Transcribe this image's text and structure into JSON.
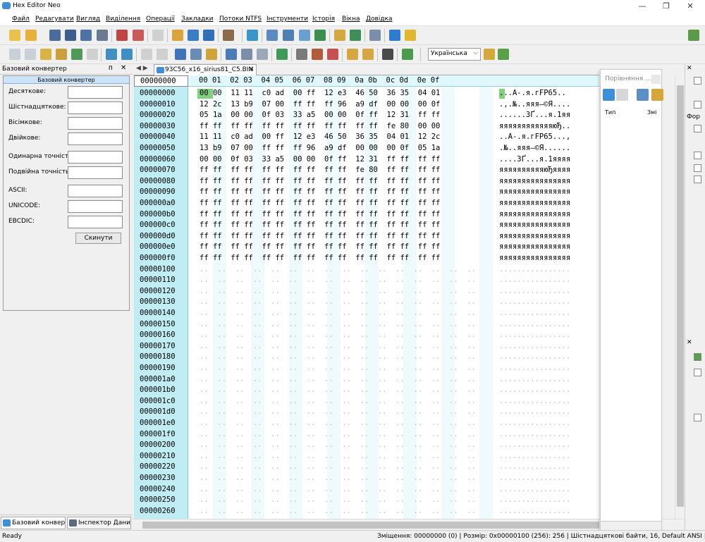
{
  "window": {
    "title": "Hex Editor Neo",
    "min": "—",
    "restore": "❐",
    "close": "✕"
  },
  "menu": [
    "Файл",
    "Редагувати",
    "Вигляд",
    "Виділення",
    "Операції",
    "Закладки",
    "Потоки NTFS",
    "Інструменти",
    "Історія",
    "Вікна",
    "Довідка"
  ],
  "toolbar": {
    "language": "Українська",
    "language_arrow": "⌵"
  },
  "converter": {
    "panel_title": "Базовий конвертер",
    "pin": "ᴨ",
    "close": "✕",
    "header": "Базовий конвертер",
    "fields": [
      {
        "label": "Десяткове:",
        "value": ""
      },
      {
        "label": "Шістнадцяткове:",
        "value": ""
      },
      {
        "label": "Вісімкове:",
        "value": ""
      },
      {
        "label": "Двійкове:",
        "value": ""
      },
      {
        "label": "Одинарна точність:",
        "value": ""
      },
      {
        "label": "Подвійна точність:",
        "value": ""
      },
      {
        "label": "ASCII:",
        "value": ""
      },
      {
        "label": "UNICODE:",
        "value": ""
      },
      {
        "label": "EBCDIC:",
        "value": ""
      }
    ],
    "reset_label": "Скинути"
  },
  "bottom_tabs": [
    "Базовий конвер...",
    "Інспектор Даних"
  ],
  "document": {
    "tab_label": "93C56_x16_sirius81_C5.BIN",
    "nav": "◀ ▶",
    "close": "✕"
  },
  "hex": {
    "offset_header": "00000000",
    "column_header": "00 01  02 03  04 05  06 07  08 09  0a 0b  0c 0d  0e 0f",
    "rows": [
      {
        "offset": "00000000",
        "hex": "00 00  11 11  c0 ad  00 ff  12 e3  46 50  36 35  04 01",
        "ascii": "...А-.я.гFP65.."
      },
      {
        "offset": "00000010",
        "hex": "12 2c  13 b9  07 00  ff ff  ff 96  a9 df  00 00  00 0f",
        "ascii": ".,.№..яяя–©Я...."
      },
      {
        "offset": "00000020",
        "hex": "05 1a  00 00  0f 03  33 a5  00 00  0f ff  12 31  ff ff",
        "ascii": "......3Ґ...я.1яя"
      },
      {
        "offset": "00000030",
        "hex": "ff ff  ff ff  ff ff  ff ff  ff ff  ff ff  fe 80  00 00",
        "ascii": "яяяяяяяяяяяяюЂ.."
      },
      {
        "offset": "00000040",
        "hex": "11 11  c0 ad  00 ff  12 e3  46 50  36 35  04 01  12 2c",
        "ascii": "..А-.я.гFP65...,"
      },
      {
        "offset": "00000050",
        "hex": "13 b9  07 00  ff ff  ff 96  a9 df  00 00  00 0f  05 1a",
        "ascii": ".№..яяя–©Я......"
      },
      {
        "offset": "00000060",
        "hex": "00 00  0f 03  33 a5  00 00  0f ff  12 31  ff ff  ff ff",
        "ascii": "....3Ґ...я.1яяяя"
      },
      {
        "offset": "00000070",
        "hex": "ff ff  ff ff  ff ff  ff ff  ff ff  fe 80  ff ff  ff ff",
        "ascii": "яяяяяяяяяяюЂяяяя"
      },
      {
        "offset": "00000080",
        "hex": "ff ff  ff ff  ff ff  ff ff  ff ff  ff ff  ff ff  ff ff",
        "ascii": "яяяяяяяяяяяяяяяя"
      },
      {
        "offset": "00000090",
        "hex": "ff ff  ff ff  ff ff  ff ff  ff ff  ff ff  ff ff  ff ff",
        "ascii": "яяяяяяяяяяяяяяяя"
      },
      {
        "offset": "000000a0",
        "hex": "ff ff  ff ff  ff ff  ff ff  ff ff  ff ff  ff ff  ff ff",
        "ascii": "яяяяяяяяяяяяяяяя"
      },
      {
        "offset": "000000b0",
        "hex": "ff ff  ff ff  ff ff  ff ff  ff ff  ff ff  ff ff  ff ff",
        "ascii": "яяяяяяяяяяяяяяяя"
      },
      {
        "offset": "000000c0",
        "hex": "ff ff  ff ff  ff ff  ff ff  ff ff  ff ff  ff ff  ff ff",
        "ascii": "яяяяяяяяяяяяяяяя"
      },
      {
        "offset": "000000d0",
        "hex": "ff ff  ff ff  ff ff  ff ff  ff ff  ff ff  ff ff  ff ff",
        "ascii": "яяяяяяяяяяяяяяяя"
      },
      {
        "offset": "000000e0",
        "hex": "ff ff  ff ff  ff ff  ff ff  ff ff  ff ff  ff ff  ff ff",
        "ascii": "яяяяяяяяяяяяяяяя"
      },
      {
        "offset": "000000f0",
        "hex": "ff ff  ff ff  ff ff  ff ff  ff ff  ff ff  ff ff  ff ff",
        "ascii": "яяяяяяяяяяяяяяяя"
      }
    ],
    "empty_offsets": [
      "00000100",
      "00000110",
      "00000120",
      "00000130",
      "00000140",
      "00000150",
      "00000160",
      "00000170",
      "00000180",
      "00000190",
      "000001a0",
      "000001b0",
      "000001c0",
      "000001d0",
      "000001e0",
      "000001f0",
      "00000200",
      "00000210",
      "00000220",
      "00000230",
      "00000240",
      "00000250",
      "00000260"
    ],
    "empty_hex": "..  ..  ..  ..  ..  ..  ..  ..  ..  ..  ..  ..  ..  ..  ..  ..",
    "empty_ascii": "................"
  },
  "compare": {
    "title": "Порівняння ...",
    "col1": "Тип",
    "col2": "Змі"
  },
  "rightstrip": {
    "x1": "✕",
    "label": "Фор",
    "x2": "✕"
  },
  "status": {
    "left": "Ready",
    "right": "Зміщення: 00000000 (0)  |  Розмір: 0x00000100 (256): 256  |  Шістнадцяткові байти, 16, Default ANSI  |  ЗАМ"
  }
}
